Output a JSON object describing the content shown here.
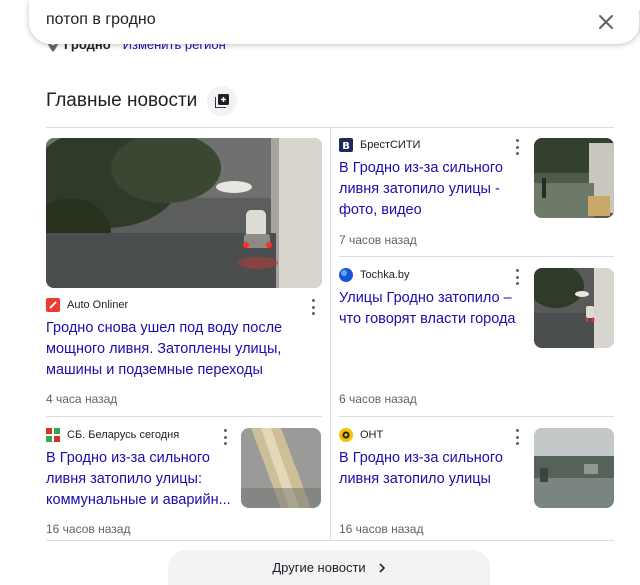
{
  "search": {
    "query": "потоп в гродно"
  },
  "region": {
    "city": "Гродно",
    "change_link": "Изменить регион"
  },
  "section": {
    "title": "Главные новости"
  },
  "articles": [
    {
      "source": "Auto Onliner",
      "headline": "Гродно снова ушел под воду после мощного ливня. Затоплены улицы, машины и подземные переходы",
      "time": "4 часа назад"
    },
    {
      "source": "БрестСИТИ",
      "headline": "В Гродно из-за сильного ливня затопило улицы - фото, видео",
      "time": "7 часов назад"
    },
    {
      "source": "Tochka.by",
      "headline": "Улицы Гродно затопило – что говорят власти города",
      "time": "6 часов назад"
    },
    {
      "source": "СБ. Беларусь сегодня",
      "headline": "В Гродно из-за сильного ливня затопило улицы: коммунальные и аварийн...",
      "time": "16 часов назад"
    },
    {
      "source": "ОНТ",
      "headline": "В Гродно из-за сильного ливня затопило улицы",
      "time": "16 часов назад"
    }
  ],
  "more": {
    "label": "Другие новости"
  },
  "colors": {
    "link": "#1a0dab",
    "muted": "#5f6368",
    "divider": "#dadce0"
  },
  "icons": {
    "clear": "close-icon",
    "pin": "location-pin-icon",
    "stack": "stack-icon",
    "menu": "more-vert-icon",
    "more": "chevron-right-icon"
  }
}
